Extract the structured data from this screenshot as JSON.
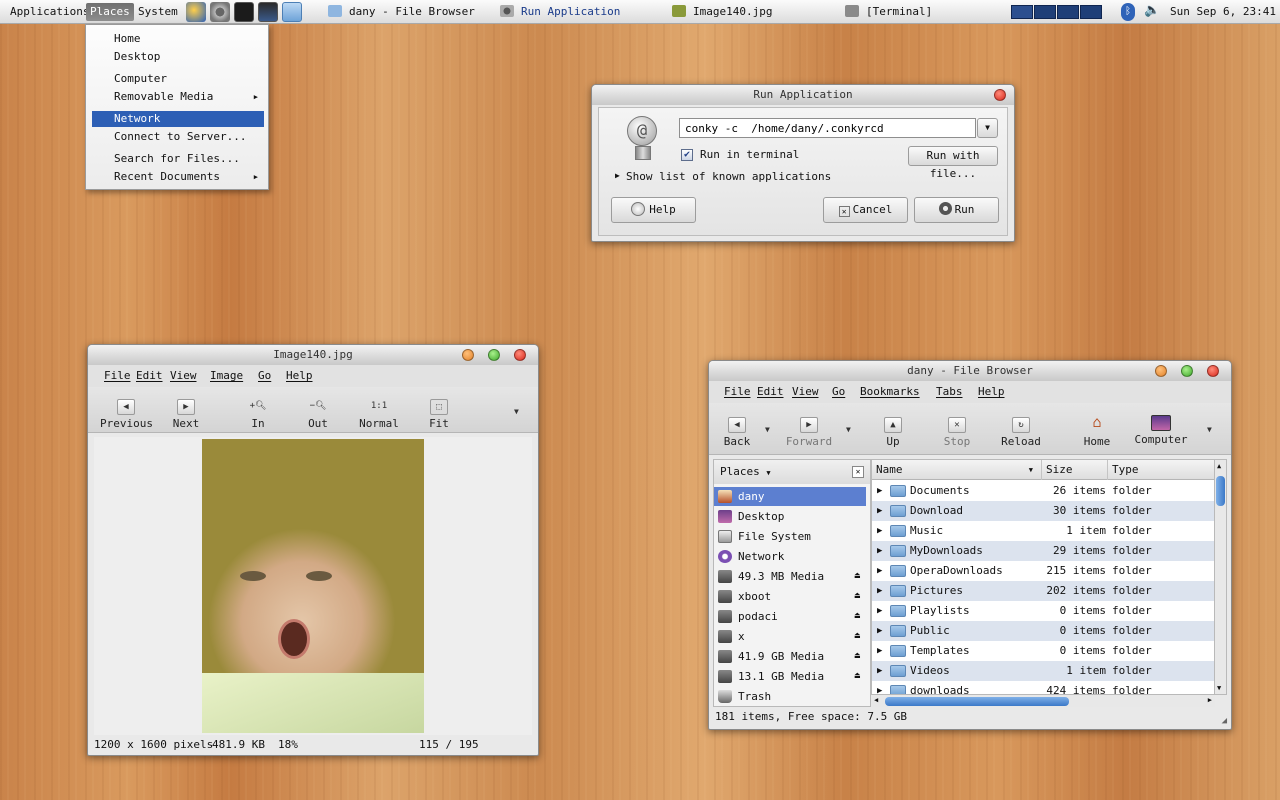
{
  "panel": {
    "menus": [
      "Applications",
      "Places",
      "System"
    ],
    "tasks": [
      {
        "label": "dany - File Browser"
      },
      {
        "label": "Run Application"
      },
      {
        "label": "Image140.jpg"
      },
      {
        "label": "[Terminal]"
      }
    ],
    "clock": "Sun Sep  6, 23:41"
  },
  "places_menu": {
    "items": [
      {
        "label": "Home"
      },
      {
        "label": "Desktop"
      },
      {
        "label": "Computer"
      },
      {
        "label": "Removable Media",
        "submenu": true
      },
      {
        "label": "Network",
        "selected": true
      },
      {
        "label": "Connect to Server..."
      },
      {
        "label": "Search for Files..."
      },
      {
        "label": "Recent Documents",
        "submenu": true
      }
    ]
  },
  "run_dialog": {
    "title": "Run Application",
    "command": "conky -c  /home/dany/.conkyrcd",
    "run_in_terminal": "Run in terminal",
    "run_with_file": "Run with file...",
    "show_list": "Show list of known applications",
    "help": "Help",
    "cancel": "Cancel",
    "run": "Run"
  },
  "image_viewer": {
    "title": "Image140.jpg",
    "menus": [
      "File",
      "Edit",
      "View",
      "Image",
      "Go",
      "Help"
    ],
    "tools": [
      "Previous",
      "Next",
      "In",
      "Out",
      "Normal",
      "Fit"
    ],
    "zoom_labels": {
      "normal_icon": "1:1"
    },
    "status": {
      "dimensions": "1200 x 1600 pixels",
      "size": "481.9 KB",
      "zoom": "18%",
      "position": "115 / 195"
    }
  },
  "file_browser": {
    "title": "dany - File Browser",
    "menus": [
      "File",
      "Edit",
      "View",
      "Go",
      "Bookmarks",
      "Tabs",
      "Help"
    ],
    "tools": [
      "Back",
      "Forward",
      "Up",
      "Stop",
      "Reload",
      "Home",
      "Computer"
    ],
    "places_label": "Places",
    "sidebar": [
      {
        "label": "dany",
        "selected": true
      },
      {
        "label": "Desktop"
      },
      {
        "label": "File System"
      },
      {
        "label": "Network"
      },
      {
        "label": "49.3 MB Media",
        "eject": true
      },
      {
        "label": "xboot",
        "eject": true
      },
      {
        "label": "podaci",
        "eject": true
      },
      {
        "label": "x",
        "eject": true
      },
      {
        "label": "41.9 GB Media",
        "eject": true
      },
      {
        "label": "13.1 GB Media",
        "eject": true
      },
      {
        "label": "Trash"
      }
    ],
    "columns": [
      "Name",
      "Size",
      "Type"
    ],
    "files": [
      {
        "name": "Documents",
        "size": "26 items",
        "type": "folder"
      },
      {
        "name": "Download",
        "size": "30 items",
        "type": "folder"
      },
      {
        "name": "Music",
        "size": "1 item",
        "type": "folder"
      },
      {
        "name": "MyDownloads",
        "size": "29 items",
        "type": "folder"
      },
      {
        "name": "OperaDownloads",
        "size": "215 items",
        "type": "folder"
      },
      {
        "name": "Pictures",
        "size": "202 items",
        "type": "folder"
      },
      {
        "name": "Playlists",
        "size": "0 items",
        "type": "folder"
      },
      {
        "name": "Public",
        "size": "0 items",
        "type": "folder"
      },
      {
        "name": "Templates",
        "size": "0 items",
        "type": "folder"
      },
      {
        "name": "Videos",
        "size": "1 item",
        "type": "folder"
      },
      {
        "name": "downloads",
        "size": "424 items",
        "type": "folder"
      }
    ],
    "status": "181 items, Free space: 7.5 GB"
  }
}
